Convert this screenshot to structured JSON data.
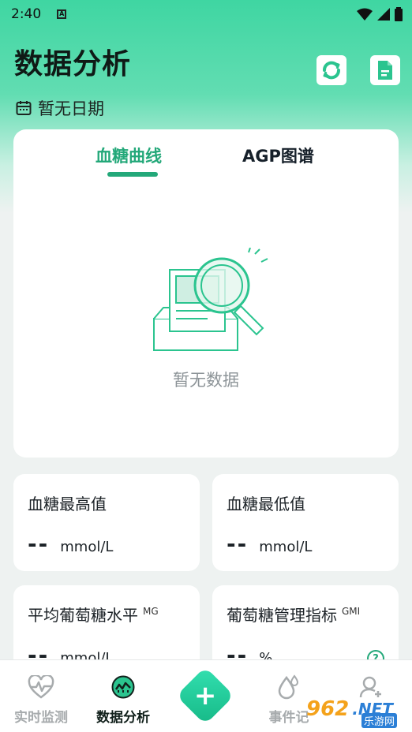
{
  "status_bar": {
    "time": "2:40",
    "notif_letter": "A"
  },
  "header": {
    "title": "数据分析",
    "date_text": "暂无日期",
    "refresh_icon": "refresh-icon",
    "report_icon": "document-icon"
  },
  "chart_card": {
    "tabs": [
      {
        "label": "血糖曲线",
        "active": true
      },
      {
        "label": "AGP图谱",
        "active": false
      }
    ],
    "empty_text": "暂无数据"
  },
  "stats": [
    {
      "label": "血糖最高值",
      "suffix": "",
      "value": "--",
      "unit": "mmol/L"
    },
    {
      "label": "血糖最低值",
      "suffix": "",
      "value": "--",
      "unit": "mmol/L"
    },
    {
      "label": "平均葡萄糖水平",
      "suffix": "MG",
      "value": "--",
      "unit": "mmol/L"
    },
    {
      "label": "葡萄糖管理指标",
      "suffix": "GMI",
      "value": "--",
      "unit": "%"
    }
  ],
  "help_icon_text": "?",
  "bottom_nav": {
    "items": [
      {
        "label": "实时监测",
        "icon": "heart-monitor-icon",
        "active": false
      },
      {
        "label": "数据分析",
        "icon": "chart-circle-icon",
        "active": true
      },
      {
        "label": "事件记",
        "icon": "drops-icon",
        "active": false
      },
      {
        "label": "",
        "icon": "user-add-icon",
        "active": false
      }
    ],
    "add_label": "+"
  },
  "watermark": {
    "number": "962",
    "domain": ".NET",
    "sub": "乐游网"
  },
  "colors": {
    "accent": "#23a879",
    "header_gradient_top": "#3fd6a2",
    "page_bg": "#eef2f1"
  }
}
